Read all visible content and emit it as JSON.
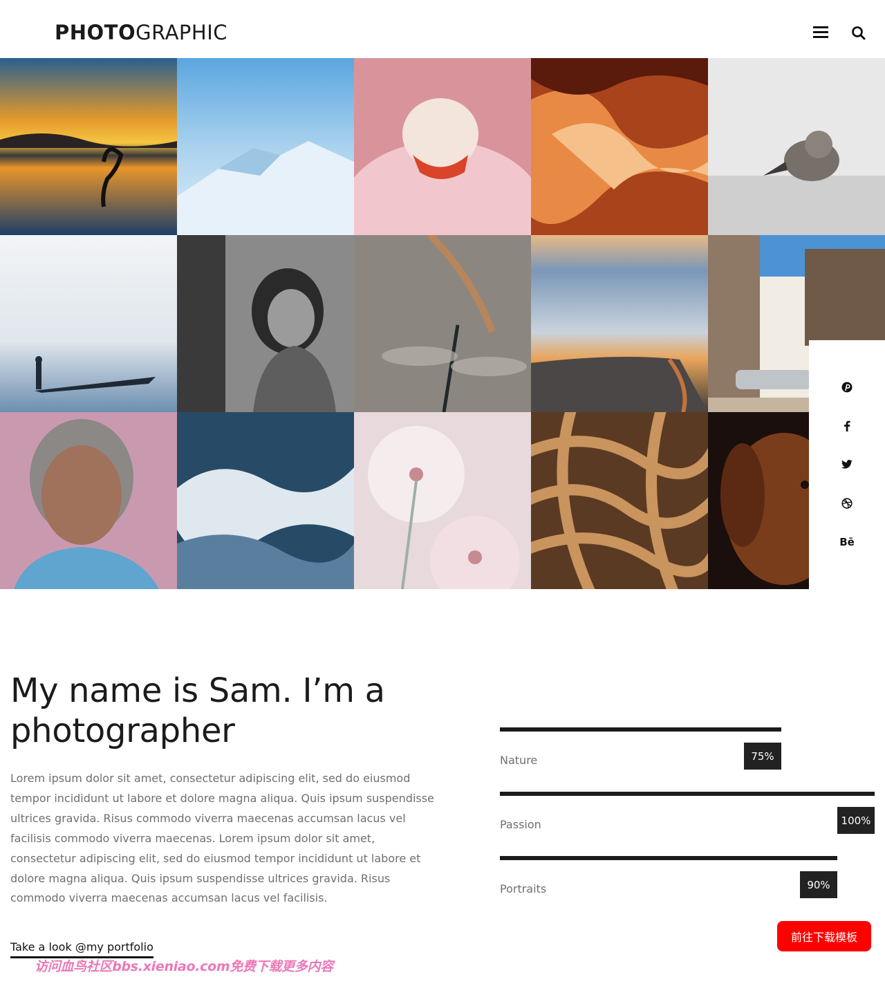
{
  "header": {
    "logo_bold": "PHOTO",
    "logo_light": "GRAPHIC",
    "menu_icon": "hamburger-menu-icon",
    "search_icon": "search-icon"
  },
  "gallery": {
    "photos": [
      "sunset-lake-yoga-silhouette",
      "snowy-mountain-range",
      "pink-flower-bud-closeup",
      "orange-sandstone-canyon",
      "small-bird-on-snow",
      "fisherman-boat-misty-lake",
      "girl-black-and-white-portrait",
      "dragonfly-on-grass",
      "road-above-clouds",
      "old-city-buildings-sunlight",
      "elderly-woman-portrait",
      "ocean-waves-aerial",
      "pink-dandelion-flower",
      "coiled-ropes",
      "brown-dog-portrait"
    ]
  },
  "social": {
    "items": [
      {
        "icon": "pinterest-icon",
        "glyph": "Ⓟ"
      },
      {
        "icon": "facebook-icon",
        "glyph": "f"
      },
      {
        "icon": "twitter-icon",
        "glyph": "🐦"
      },
      {
        "icon": "dribbble-icon",
        "glyph": "◎"
      },
      {
        "icon": "behance-icon",
        "glyph": "Bē"
      }
    ]
  },
  "about": {
    "title": "My name is Sam. I’m a photographer",
    "paragraph": "Lorem ipsum dolor sit amet, consectetur adipiscing elit, sed do eiusmod tempor incididunt ut labore et dolore magna aliqua. Quis ipsum suspendisse ultrices gravida. Risus commodo viverra maecenas accumsan lacus vel facilisis commodo viverra maecenas. Lorem ipsum dolor sit amet, consectetur adipiscing elit, sed do eiusmod tempor incididunt ut labore et dolore magna aliqua. Quis ipsum suspendisse ultrices gravida. Risus commodo viverra maecenas accumsan lacus vel facilisis.",
    "link_label": "Take a look @my portfolio"
  },
  "skills": [
    {
      "label": "Nature",
      "percent": 75,
      "percent_label": "75%"
    },
    {
      "label": "Passion",
      "percent": 100,
      "percent_label": "100%"
    },
    {
      "label": "Portraits",
      "percent": 90,
      "percent_label": "90%"
    }
  ],
  "download_button": "前往下载模板",
  "watermark": "访问血鸟社区bbs.xieniao.com免费下载更多内容",
  "colors": {
    "text_dark": "#1b1b1b",
    "text_muted": "#6f6f6f",
    "download_red": "#ff0000",
    "watermark_pink": "#ec78b8"
  }
}
